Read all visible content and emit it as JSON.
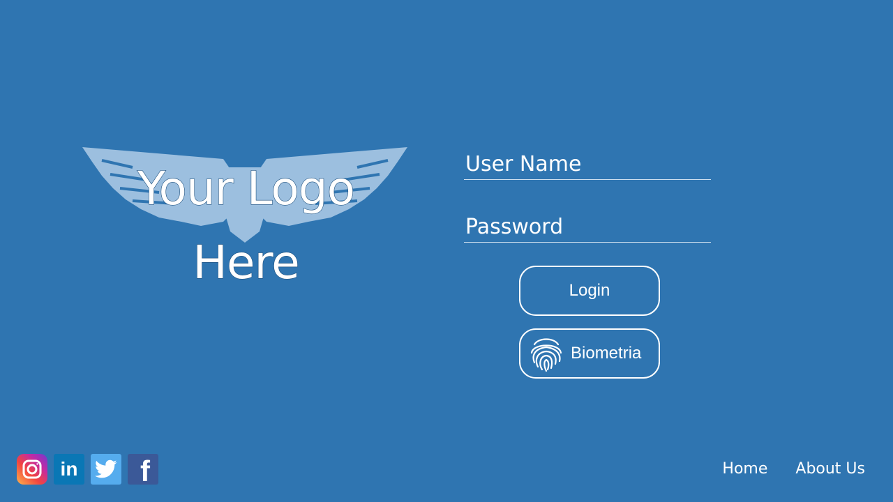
{
  "logo": {
    "line1": "Your Logo",
    "line2": "Here",
    "graphic_icon": "eagle-wings-logo"
  },
  "form": {
    "username_placeholder": "User Name",
    "password_placeholder": "Password",
    "login_label": "Login",
    "biometric_label": "Biometria",
    "biometric_icon": "fingerprint-icon"
  },
  "social": [
    {
      "name": "instagram-icon"
    },
    {
      "name": "linkedin-icon",
      "text": "in"
    },
    {
      "name": "twitter-icon"
    },
    {
      "name": "facebook-icon",
      "text": "f"
    }
  ],
  "nav": {
    "home": "Home",
    "about": "About Us"
  },
  "colors": {
    "background": "#2f75b1",
    "wing_fill": "#9cbfdf",
    "text": "#ffffff"
  }
}
